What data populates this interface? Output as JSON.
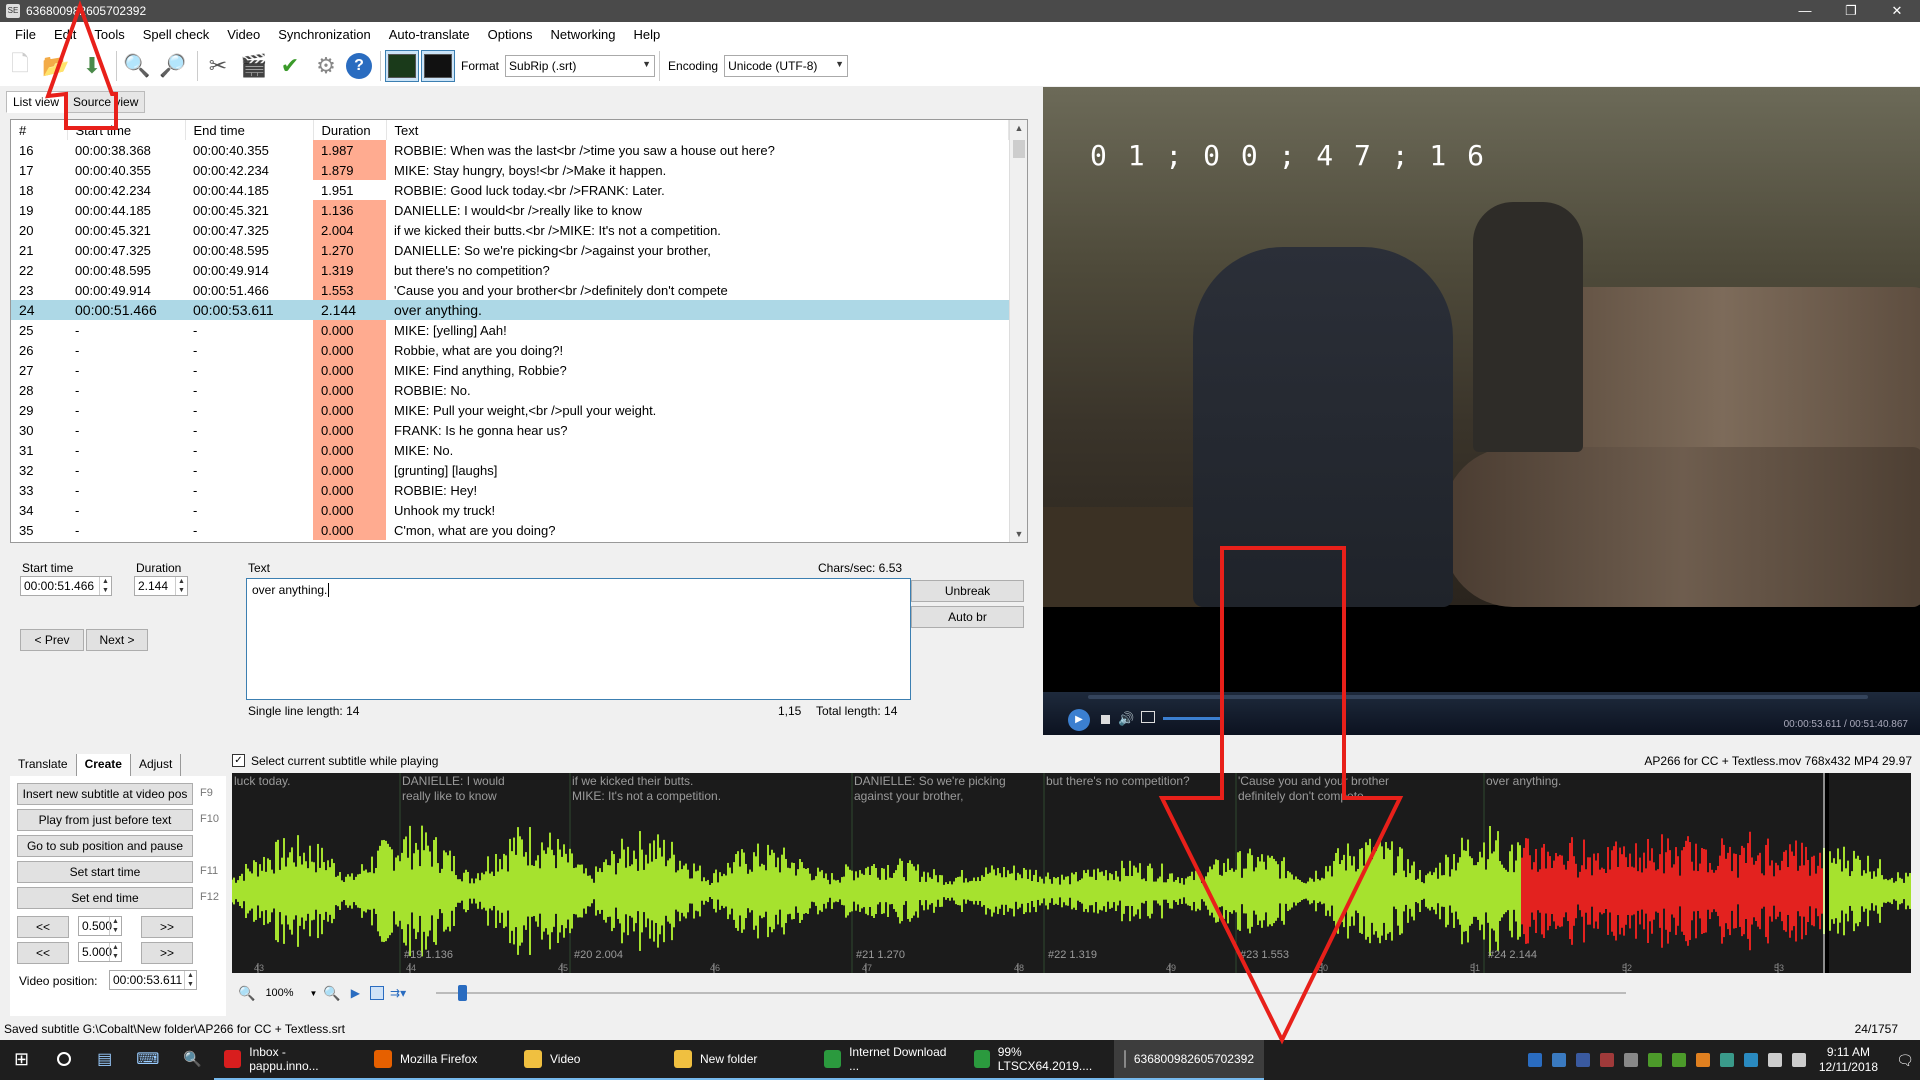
{
  "window": {
    "title": "636800982605702392",
    "controls": [
      "—",
      "❐",
      "✕"
    ]
  },
  "menu": [
    "File",
    "Edit",
    "Tools",
    "Spell check",
    "Video",
    "Synchronization",
    "Auto-translate",
    "Options",
    "Networking",
    "Help"
  ],
  "toolbar": {
    "format_label": "Format",
    "format_value": "SubRip (.srt)",
    "encoding_label": "Encoding",
    "encoding_value": "Unicode (UTF-8)"
  },
  "view_tabs": [
    "List view",
    "Source view"
  ],
  "table": {
    "headers": [
      "#",
      "Start time",
      "End time",
      "Duration",
      "Text"
    ],
    "rows": [
      {
        "num": "16",
        "start": "00:00:38.368",
        "end": "00:00:40.355",
        "dur": "1.987",
        "text": "ROBBIE: When was the last<br />time you saw a house out here?",
        "warn": true
      },
      {
        "num": "17",
        "start": "00:00:40.355",
        "end": "00:00:42.234",
        "dur": "1.879",
        "text": "MIKE: Stay hungry, boys!<br />Make it happen.",
        "warn": true
      },
      {
        "num": "18",
        "start": "00:00:42.234",
        "end": "00:00:44.185",
        "dur": "1.951",
        "text": "ROBBIE: Good luck today.<br />FRANK: Later.",
        "warn": false
      },
      {
        "num": "19",
        "start": "00:00:44.185",
        "end": "00:00:45.321",
        "dur": "1.136",
        "text": "DANIELLE: I would<br />really like to know",
        "warn": true
      },
      {
        "num": "20",
        "start": "00:00:45.321",
        "end": "00:00:47.325",
        "dur": "2.004",
        "text": "if we kicked their butts.<br />MIKE: It's not a competition.",
        "warn": true
      },
      {
        "num": "21",
        "start": "00:00:47.325",
        "end": "00:00:48.595",
        "dur": "1.270",
        "text": "DANIELLE: So we're picking<br />against your brother,",
        "warn": true
      },
      {
        "num": "22",
        "start": "00:00:48.595",
        "end": "00:00:49.914",
        "dur": "1.319",
        "text": "but there's no competition?",
        "warn": true
      },
      {
        "num": "23",
        "start": "00:00:49.914",
        "end": "00:00:51.466",
        "dur": "1.553",
        "text": "'Cause you and your brother<br />definitely don't compete",
        "warn": true
      },
      {
        "num": "24",
        "start": "00:00:51.466",
        "end": "00:00:53.611",
        "dur": "2.144",
        "text": "over anything.",
        "warn": false,
        "selected": true
      },
      {
        "num": "25",
        "start": "-",
        "end": "-",
        "dur": "0.000",
        "text": "MIKE: [yelling] Aah!",
        "warn": true
      },
      {
        "num": "26",
        "start": "-",
        "end": "-",
        "dur": "0.000",
        "text": "Robbie, what are you doing?!",
        "warn": true
      },
      {
        "num": "27",
        "start": "-",
        "end": "-",
        "dur": "0.000",
        "text": "MIKE: Find anything, Robbie?",
        "warn": true
      },
      {
        "num": "28",
        "start": "-",
        "end": "-",
        "dur": "0.000",
        "text": "ROBBIE: No.",
        "warn": true
      },
      {
        "num": "29",
        "start": "-",
        "end": "-",
        "dur": "0.000",
        "text": "MIKE: Pull your weight,<br />pull your weight.",
        "warn": true
      },
      {
        "num": "30",
        "start": "-",
        "end": "-",
        "dur": "0.000",
        "text": "FRANK: Is he gonna hear us?",
        "warn": true
      },
      {
        "num": "31",
        "start": "-",
        "end": "-",
        "dur": "0.000",
        "text": "MIKE: No.",
        "warn": true
      },
      {
        "num": "32",
        "start": "-",
        "end": "-",
        "dur": "0.000",
        "text": "[grunting] [laughs]",
        "warn": true
      },
      {
        "num": "33",
        "start": "-",
        "end": "-",
        "dur": "0.000",
        "text": "ROBBIE: Hey!",
        "warn": true
      },
      {
        "num": "34",
        "start": "-",
        "end": "-",
        "dur": "0.000",
        "text": "Unhook my truck!",
        "warn": true
      },
      {
        "num": "35",
        "start": "-",
        "end": "-",
        "dur": "0.000",
        "text": "C'mon, what are you doing?",
        "warn": true
      }
    ]
  },
  "edit": {
    "start_time_label": "Start time",
    "start_time_value": "00:00:51.466",
    "duration_label": "Duration",
    "duration_value": "2.144",
    "text_label": "Text",
    "chars_sec": "Chars/sec: 6.53",
    "text_value": "over anything.",
    "prev_label": "< Prev",
    "next_label": "Next >",
    "unbreak_label": "Unbreak",
    "autobr_label": "Auto br",
    "single_line": "Single line length: 14",
    "cursor_pos": "1,15",
    "total_length": "Total length: 14"
  },
  "video": {
    "timecode": "0 1 ; 0 0 ; 4 7 ; 1 6",
    "time_display": "00:00:53.611 / 00:51:40.867"
  },
  "bottom": {
    "tabs": [
      "Translate",
      "Create",
      "Adjust"
    ],
    "select_while_playing": "Select current subtitle while playing",
    "media_info": "AP266 for CC + Textless.mov 768x432 MP4 29.97",
    "buttons": [
      {
        "label": "Insert new subtitle at video pos",
        "key": "F9"
      },
      {
        "label": "Play from just before text",
        "key": "F10"
      },
      {
        "label": "Go to sub position and pause",
        "key": ""
      },
      {
        "label": "Set start time",
        "key": "F11"
      },
      {
        "label": "Set end time",
        "key": "F12"
      }
    ],
    "step1_value": "0.500",
    "step2_value": "5.000",
    "back_label": "<<",
    "fwd_label": ">>",
    "video_pos_label": "Video position:",
    "video_pos_value": "00:00:53.611",
    "zoom_value": "100%"
  },
  "waveform": {
    "segments": [
      {
        "text1": "luck today.",
        "text2": "",
        "info": ""
      },
      {
        "text1": "DANIELLE: I would",
        "text2": "really like to know",
        "info": "#19  1.136"
      },
      {
        "text1": "if we kicked their butts.",
        "text2": "MIKE: It's not a competition.",
        "info": "#20  2.004"
      },
      {
        "text1": "DANIELLE: So we're picking",
        "text2": "against your brother,",
        "info": "#21  1.270"
      },
      {
        "text1": "but there's no competition?",
        "text2": "",
        "info": "#22  1.319"
      },
      {
        "text1": "'Cause you and your brother",
        "text2": "definitely don't compete",
        "info": "#23  1.553"
      },
      {
        "text1": "over anything.",
        "text2": "",
        "info": "#24  2.144"
      }
    ],
    "ticks": [
      "43",
      "44",
      "45",
      "46",
      "47",
      "48",
      "49",
      "50",
      "51",
      "52",
      "53"
    ]
  },
  "status": {
    "left": "Saved subtitle G:\\Cobalt\\New folder\\AP266 for CC + Textless.srt",
    "right": "24/1757"
  },
  "taskbar": {
    "items": [
      {
        "label": "Inbox - pappu.inno...",
        "color": "#d81e1e"
      },
      {
        "label": "Mozilla Firefox",
        "color": "#e66000"
      },
      {
        "label": "Video",
        "color": "#f0c040"
      },
      {
        "label": "New folder",
        "color": "#f0c040"
      },
      {
        "label": "Internet Download ...",
        "color": "#2b9a3e"
      },
      {
        "label": "99% LTSCX64.2019....",
        "color": "#2b9a3e"
      },
      {
        "label": "636800982605702392",
        "color": "#888888"
      }
    ],
    "time": "9:11 AM",
    "date": "12/11/2018"
  }
}
